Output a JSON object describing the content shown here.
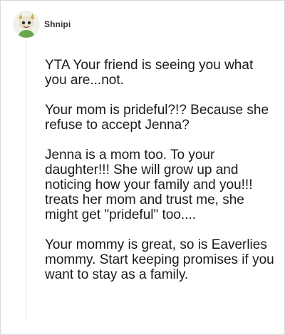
{
  "comment": {
    "username": "Shnipi",
    "avatar_icon": "cartoon-avatar-icon",
    "paragraphs": [
      "YTA Your friend is seeing you what you are...not.",
      "Your mom is prideful?!? Because she refuse to accept Jenna?",
      "Jenna is a mom too. To your daughter!!! She will grow up and noticing how your family and you!!! treats her mom and trust me, she might get \"prideful\" too....",
      "Your mommy is great, so is Eaverlies mommy. Start keeping promises if you want to stay as a family."
    ]
  },
  "colors": {
    "text": "#1a1a1a",
    "username": "#333333",
    "border": "#d8d8d8",
    "thread_line": "#e2e2e2"
  }
}
